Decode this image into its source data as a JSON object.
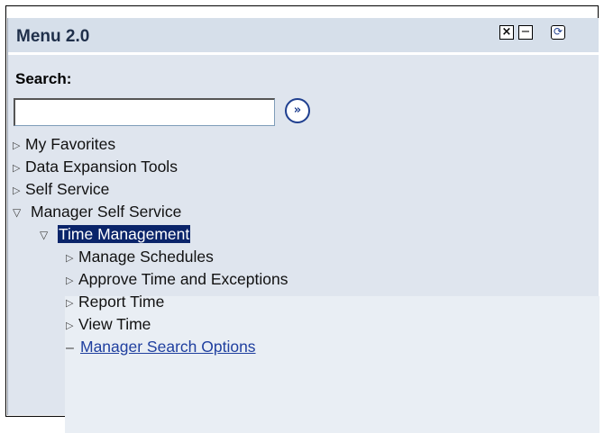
{
  "window": {
    "title": "Menu 2.0",
    "icons": {
      "close": "close-icon",
      "minimize": "minimize-icon",
      "refresh": "refresh-icon"
    }
  },
  "search": {
    "label": "Search:",
    "value": "",
    "placeholder": "",
    "go_icon": "go-arrows-icon"
  },
  "menu": {
    "items": [
      {
        "label": "My Favorites",
        "state": "collapsed"
      },
      {
        "label": "Data Expansion Tools",
        "state": "collapsed"
      },
      {
        "label": "Self Service",
        "state": "collapsed"
      },
      {
        "label": "Manager Self Service",
        "state": "expanded"
      }
    ],
    "submenu": {
      "label": "Time Management",
      "state": "expanded",
      "selected": true,
      "items": [
        {
          "label": "Manage Schedules",
          "state": "collapsed"
        },
        {
          "label": "Approve Time and Exceptions",
          "state": "collapsed"
        },
        {
          "label": "Report Time",
          "state": "collapsed"
        },
        {
          "label": "View Time",
          "state": "collapsed"
        },
        {
          "label": "Manager Search Options",
          "state": "link"
        }
      ]
    }
  },
  "colors": {
    "panel_bg": "#dfe5ee",
    "selected_bg": "#0a246a",
    "link": "#1f3f9f"
  }
}
